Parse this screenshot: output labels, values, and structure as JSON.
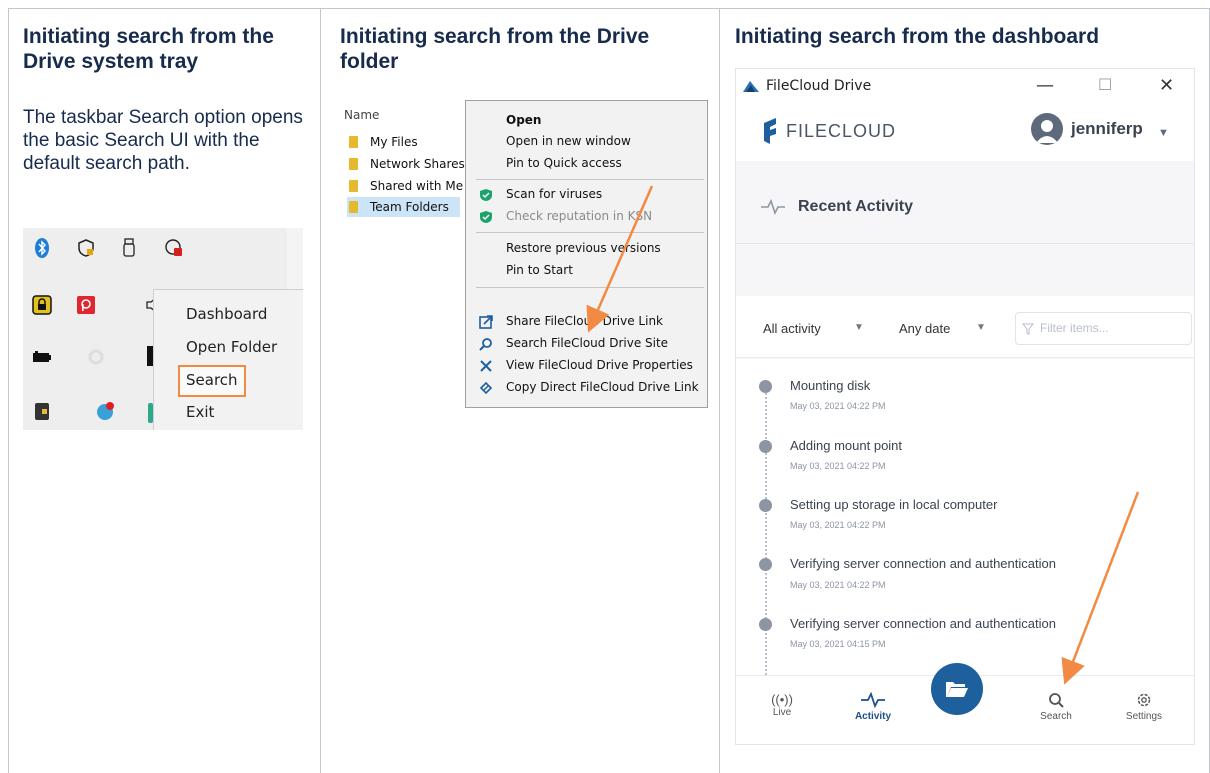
{
  "columns": [
    {
      "title": "Initiating search from the Drive system tray",
      "body": "The taskbar Search option opens the basic Search UI with the default search path."
    },
    {
      "title": "Initiating search from the Drive folder"
    },
    {
      "title": "Initiating search from the dashboard"
    }
  ],
  "tray": {
    "menu": [
      "Dashboard",
      "Open Folder",
      "Search",
      "Exit"
    ],
    "highlight_color": "#f28a44"
  },
  "explorer": {
    "header": "Name",
    "folders": [
      "My Files",
      "Network Shares",
      "Shared with Me",
      "Team Folders"
    ],
    "context_menu": [
      {
        "label": "Open",
        "bold": true
      },
      {
        "label": "Open in new window"
      },
      {
        "label": "Pin to Quick access"
      },
      {
        "label": "Scan for viruses",
        "icon": "shield-icon"
      },
      {
        "label": "Check reputation in KSN",
        "icon": "shield-icon",
        "dim": true
      },
      {
        "label": "Restore previous versions"
      },
      {
        "label": "Pin to Start"
      },
      {
        "label": "Share FileCloud Drive Link",
        "icon": "share-icon"
      },
      {
        "label": "Search FileCloud Drive Site",
        "icon": "search-icon"
      },
      {
        "label": "View FileCloud Drive Properties",
        "icon": "tools-icon"
      },
      {
        "label": "Copy Direct FileCloud Drive Link",
        "icon": "link-icon"
      }
    ]
  },
  "filecloud": {
    "window_title": "FileCloud Drive",
    "logo": "FILECLOUD",
    "user": "jenniferp",
    "section_title": "Recent Activity",
    "filter_activity": "All activity",
    "filter_date": "Any date",
    "filter_placeholder": "Filter items...",
    "activities": [
      {
        "text": "Mounting disk",
        "time": "May 03, 2021 04:22 PM"
      },
      {
        "text": "Adding mount point",
        "time": "May 03, 2021 04:22 PM"
      },
      {
        "text": "Setting up storage in local computer",
        "time": "May 03, 2021 04:22 PM"
      },
      {
        "text": "Verifying server connection and authentication",
        "time": "May 03, 2021 04:22 PM"
      },
      {
        "text": "Verifying server connection and authentication",
        "time": "May 03, 2021 04:15 PM"
      }
    ],
    "nav": [
      "Live",
      "Activity",
      "Search",
      "Settings"
    ],
    "accent": "#1e5f9e",
    "arrow_color": "#f28a44"
  }
}
